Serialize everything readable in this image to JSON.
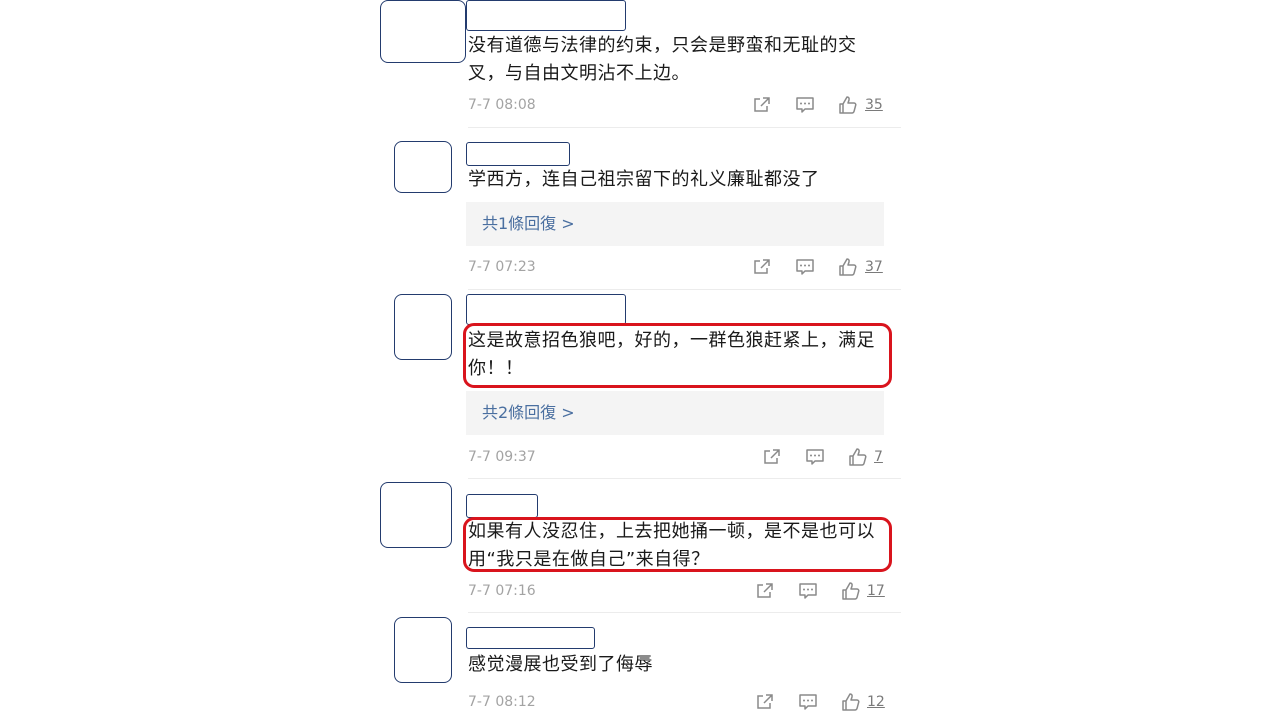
{
  "comments": [
    {
      "text": "没有道德与法律的约束，只会是野蛮和无耻的交叉，与自由文明沾不上边。",
      "time": "7-7 08:08",
      "likes": "35"
    },
    {
      "text": "学西方，连自己祖宗留下的礼义廉耻都没了",
      "replies": "共1條回復 >",
      "time": "7-7 07:23",
      "likes": "37"
    },
    {
      "text": "这是故意招色狼吧，好的，一群色狼赶紧上，满足你！！",
      "replies": "共2條回復 >",
      "time": "7-7 09:37",
      "likes": "7"
    },
    {
      "text": "如果有人没忍住，上去把她捅一顿，是不是也可以用“我只是在做自己”来自得？",
      "time": "7-7 07:16",
      "likes": "17"
    },
    {
      "text": "感觉漫展也受到了侮辱",
      "time": "7-7 08:12",
      "likes": "12"
    }
  ],
  "icons": {
    "share": "share-icon",
    "comment": "comment-icon",
    "like": "thumbs-up-icon"
  },
  "colors": {
    "highlight": "#d9141d",
    "avatar_border": "#233b6e",
    "reply_link": "#4a6fa0",
    "timestamp": "#a3a3a3"
  }
}
